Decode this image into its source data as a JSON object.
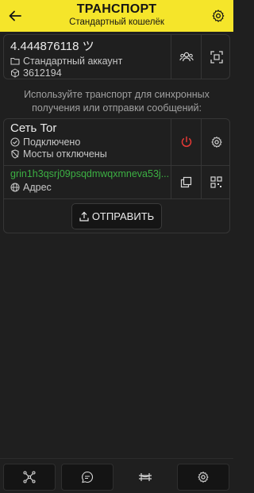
{
  "header": {
    "title": "ТРАНСПОРТ",
    "subtitle": "Стандартный кошелёк",
    "back_icon": "arrow-left-icon",
    "settings_icon": "gear-icon",
    "background": "#f5e52a"
  },
  "wallet": {
    "balance": "4.444876118 ツ",
    "account": "Стандартный аккаунт",
    "height": "3612194"
  },
  "info_text": "Используйте транспорт для синхронных получения или отправки сообщений:",
  "tor": {
    "title": "Сеть Tor",
    "status": "Подключено",
    "bridges": "Мосты отключены",
    "power_color": "#e53935"
  },
  "address": {
    "value": "grin1h3qsrj09psqdmwqxmneva53j...",
    "label": "Адрес",
    "color": "#3cb043"
  },
  "send_button": {
    "label": "ОТПРАВИТЬ"
  },
  "bottom_nav": {
    "items": [
      "network-icon",
      "chat-icon",
      "bridge-icon",
      "gear-icon"
    ],
    "active_index": 2
  }
}
